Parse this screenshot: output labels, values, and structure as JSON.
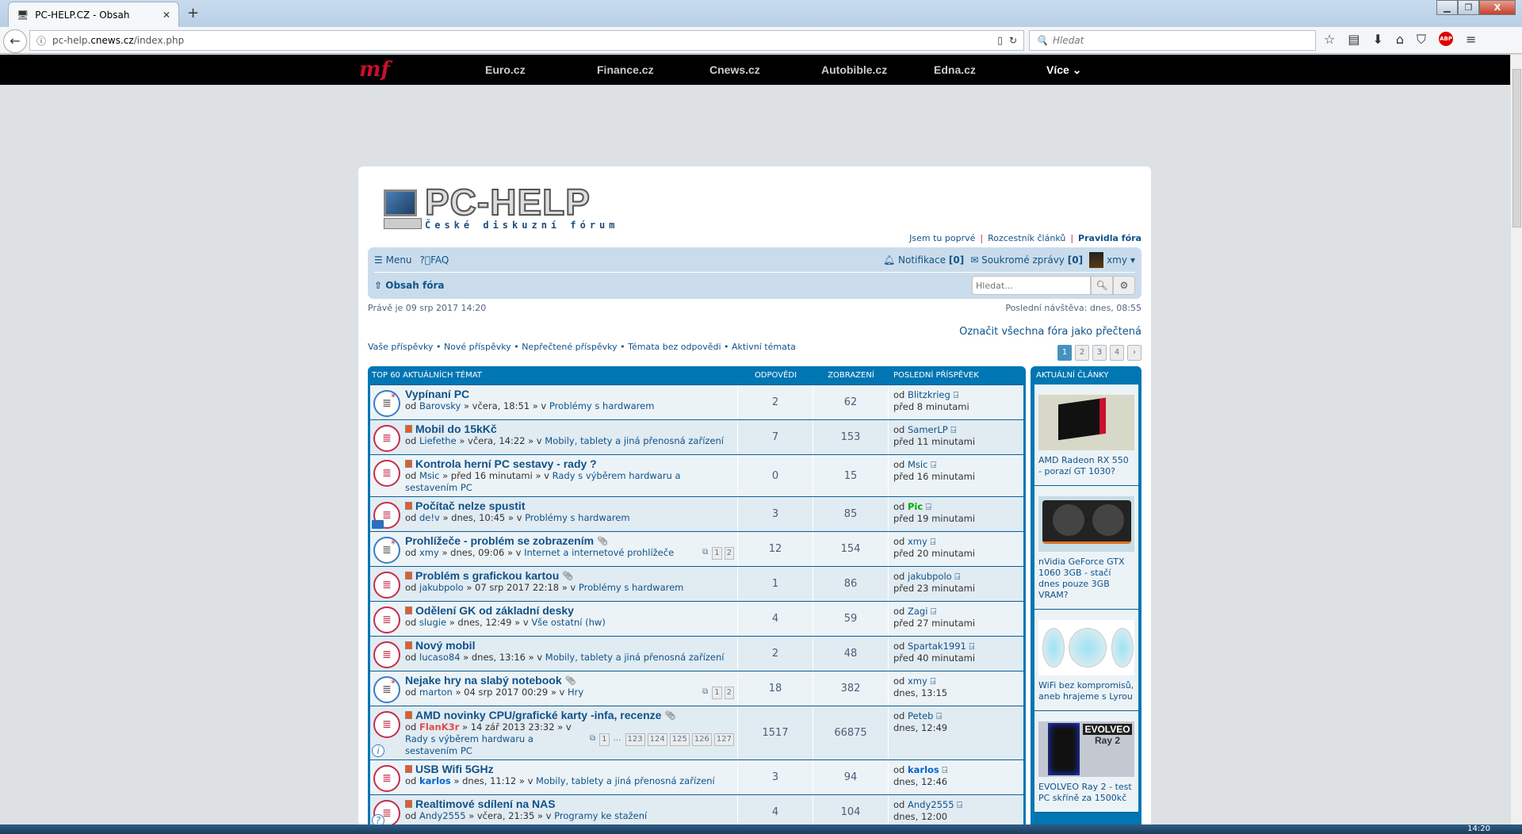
{
  "browser": {
    "tab_title": "PC-HELP.CZ - Obsah",
    "url_domain_prefix": "pc-help.",
    "url_domain": "cnews.cz",
    "url_path": "/index.php",
    "search_placeholder": "Hledat",
    "clock": "14:20"
  },
  "network": {
    "logo": "mf",
    "links": [
      "Euro.cz",
      "Finance.cz",
      "Cnews.cz",
      "Autobible.cz",
      "Edna.cz"
    ],
    "more": "Více"
  },
  "forum": {
    "brand": "PC-HELP",
    "slogan": "České diskuzní fórum",
    "toplinks": [
      "Jsem tu poprvé",
      "Rozcestník článků",
      "Pravidla fóra"
    ],
    "menu": "Menu",
    "faq": "FAQ",
    "notifications": "Notifikace",
    "notifications_count": "[0]",
    "messages": "Soukromé zprávy",
    "messages_count": "[0]",
    "user": "xmy",
    "breadcrumb": "Obsah fóra",
    "search_placeholder": "Hledat…",
    "now": "Právě je 09 srp 2017 14:20",
    "last_visit": "Poslední návštěva: dnes, 08:55",
    "mark_all": "Označit všechna fóra jako přečtená",
    "quick_links": [
      "Vaše příspěvky",
      "Nové příspěvky",
      "Nepřečtené příspěvky",
      "Témata bez odpovědi",
      "Aktivní témata"
    ],
    "pages": [
      "1",
      "2",
      "3",
      "4",
      "›"
    ],
    "current_page": "1"
  },
  "table": {
    "headers": [
      "TOP 60 AKTUÁLNÍCH TÉMAT",
      "ODPOVĚDI",
      "ZOBRAZENÍ",
      "POSLEDNÍ PŘÍSPĚVEK"
    ],
    "rows": [
      {
        "title": "Vypínaní PC",
        "hot": false,
        "attach": false,
        "unread": true,
        "author": "Barovsky",
        "date": "včera, 18:51",
        "forum": "Problémy s hardwarem",
        "pages": [],
        "replies": "2",
        "views": "62",
        "last_author": "Blitzkrieg",
        "last_time": "před 8 minutami"
      },
      {
        "title": "Mobil do 15kKč",
        "hot": true,
        "attach": false,
        "unread": false,
        "author": "Liefethe",
        "date": "včera, 14:22",
        "forum": "Mobily, tablety a jiná přenosná zařízení",
        "pages": [],
        "replies": "7",
        "views": "153",
        "last_author": "SamerLP",
        "last_time": "před 11 minutami"
      },
      {
        "title": "Kontrola herní PC sestavy - rady ?",
        "hot": true,
        "attach": false,
        "unread": false,
        "author": "Msic",
        "date": "před 16 minutami",
        "forum": "Rady s výběrem hardwaru a sestavením PC",
        "pages": [],
        "replies": "0",
        "views": "15",
        "last_author": "Msic",
        "last_time": "před 16 minutami"
      },
      {
        "title": "Počítač nelze spustit",
        "hot": true,
        "attach": false,
        "unread": false,
        "badge": "computer",
        "author": "de!v",
        "date": "dnes, 10:45",
        "forum": "Problémy s hardwarem",
        "pages": [],
        "replies": "3",
        "views": "85",
        "last_author": "Pic",
        "last_author_color": "#00aa00",
        "last_time": "před 19 minutami"
      },
      {
        "title": "Prohlížeče - problém se zobrazením",
        "hot": false,
        "attach": true,
        "unread": true,
        "author": "xmy",
        "date": "dnes, 09:06",
        "forum": "Internet a internetové prohlížeče",
        "pages": [
          "1",
          "2"
        ],
        "replies": "12",
        "views": "154",
        "last_author": "xmy",
        "last_time": "před 20 minutami"
      },
      {
        "title": "Problém s grafickou kartou",
        "hot": true,
        "attach": true,
        "unread": false,
        "author": "jakubpolo",
        "date": "07 srp 2017 22:18",
        "forum": "Problémy s hardwarem",
        "pages": [],
        "replies": "1",
        "views": "86",
        "last_author": "jakubpolo",
        "last_time": "před 23 minutami"
      },
      {
        "title": "Odělení GK od základní desky",
        "hot": true,
        "attach": false,
        "unread": false,
        "author": "slugie",
        "date": "dnes, 12:49",
        "forum": "Vše ostatní (hw)",
        "pages": [],
        "replies": "4",
        "views": "59",
        "last_author": "Zagi",
        "last_time": "před 27 minutami"
      },
      {
        "title": "Nový mobil",
        "hot": true,
        "attach": false,
        "unread": false,
        "author": "lucaso84",
        "date": "dnes, 13:16",
        "forum": "Mobily, tablety a jiná přenosná zařízení",
        "pages": [],
        "replies": "2",
        "views": "48",
        "last_author": "Spartak1991",
        "last_time": "před 40 minutami"
      },
      {
        "title": "Nejake hry na slabý notebook",
        "hot": false,
        "attach": true,
        "unread": true,
        "author": "marton",
        "date": "04 srp 2017 00:29",
        "forum": "Hry",
        "pages": [
          "1",
          "2"
        ],
        "replies": "18",
        "views": "382",
        "last_author": "xmy",
        "last_time": "dnes, 13:15"
      },
      {
        "title": "AMD novinky CPU/grafické karty -infa, recenze",
        "hot": true,
        "attach": true,
        "unread": false,
        "badge": "info",
        "author": "FlanK3r",
        "author_color": "#e24a4a",
        "date": "14 zář 2013 23:32",
        "forum": "Rady s výběrem hardwaru a sestavením PC",
        "pages": [
          "1",
          "…",
          "123",
          "124",
          "125",
          "126",
          "127"
        ],
        "replies": "1517",
        "views": "66875",
        "last_author": "Peteb",
        "last_time": "dnes, 12:49"
      },
      {
        "title": "USB Wifi 5GHz",
        "hot": true,
        "attach": false,
        "unread": false,
        "author": "karlos",
        "author_color": "#0066cc",
        "date": "dnes, 11:12",
        "forum": "Mobily, tablety a jiná přenosná zařízení",
        "pages": [],
        "replies": "3",
        "views": "94",
        "last_author": "karlos",
        "last_author_color": "#0066cc",
        "last_time": "dnes, 12:46"
      },
      {
        "title": "Realtimové sdílení na NAS",
        "hot": true,
        "attach": false,
        "unread": false,
        "badge": "question",
        "author": "Andy2555",
        "date": "včera, 21:35",
        "forum": "Programy ke stažení",
        "pages": [],
        "replies": "4",
        "views": "104",
        "last_author": "Andy2555",
        "last_time": "dnes, 12:00"
      }
    ]
  },
  "sidebar": {
    "title": "AKTUÁLNÍ ČLÁNKY",
    "articles": [
      {
        "title": "AMD Radeon RX 550 - porazí GT 1030?"
      },
      {
        "title": "nVidia GeForce GTX 1060 3GB - stačí dnes pouze 3GB VRAM?"
      },
      {
        "title": "WiFi bez kompromisů, aneb hrajeme s Lyrou"
      },
      {
        "title": "EVOLVEO Ray 2 - test PC skříně za 1500kč",
        "img_text": [
          "EVOLVEO",
          "Ray 2"
        ]
      }
    ]
  },
  "labels": {
    "by": "od",
    "in": "v"
  }
}
